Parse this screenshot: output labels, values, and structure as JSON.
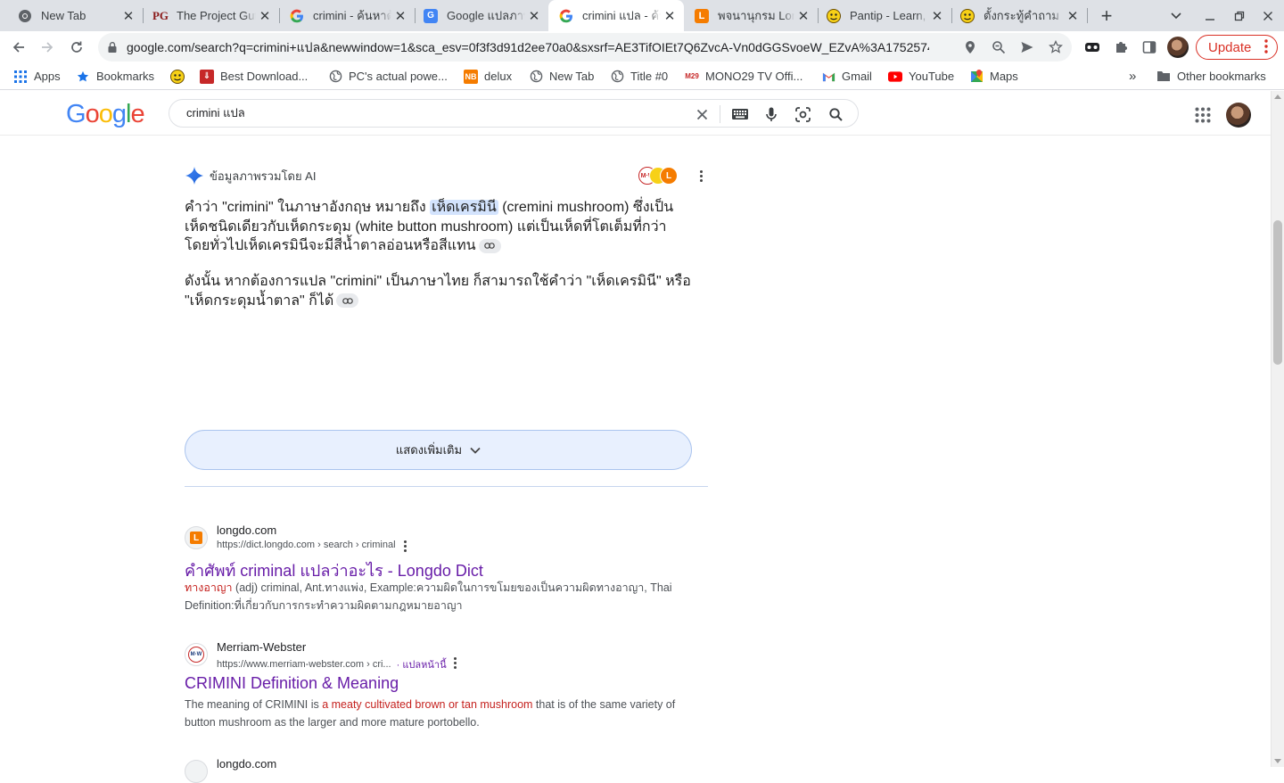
{
  "browser": {
    "tabs": [
      {
        "title": "New Tab",
        "favicon": "chrome-icon",
        "active": false
      },
      {
        "title": "The Project Gutenberg",
        "favicon": "gutenberg-icon",
        "active": false
      },
      {
        "title": "crimini - ค้นหาด้วย Google",
        "favicon": "google-icon",
        "active": false
      },
      {
        "title": "Google แปลภาษา",
        "favicon": "google-translate-icon",
        "active": false
      },
      {
        "title": "crimini แปล - ค้นหาด้วย Google",
        "favicon": "google-icon",
        "active": true
      },
      {
        "title": "พจนานุกรม Longdo",
        "favicon": "longdo-icon",
        "active": false
      },
      {
        "title": "Pantip - Learn, Share",
        "favicon": "pantip-icon",
        "active": false
      },
      {
        "title": "ตั้งกระทู้คำถาม",
        "favicon": "pantip-icon",
        "active": false
      }
    ],
    "address": "google.com/search?q=crimini+แปล&newwindow=1&sca_esv=0f3f3d91d2ee70a0&sxsrf=AE3TifOIEt7Q6ZvcA-Vn0dGGSvoeW_EZvA%3A17525742...",
    "update_label": "Update",
    "bookmarks": [
      {
        "label": "Apps",
        "icon": "apps-grid-icon"
      },
      {
        "label": "Bookmarks",
        "icon": "star-icon"
      },
      {
        "label": "",
        "icon": "pantip-icon"
      },
      {
        "label": "Best Download...",
        "icon": "download-icon"
      },
      {
        "label": "PC's actual powe...",
        "icon": "globe-icon"
      },
      {
        "label": "delux",
        "icon": "nb-icon"
      },
      {
        "label": "New Tab",
        "icon": "globe-icon"
      },
      {
        "label": "Title #0",
        "icon": "globe-icon"
      },
      {
        "label": "MONO29 TV Offi...",
        "icon": "mono29-icon"
      },
      {
        "label": "Gmail",
        "icon": "gmail-icon"
      },
      {
        "label": "YouTube",
        "icon": "youtube-icon"
      },
      {
        "label": "Maps",
        "icon": "maps-icon"
      }
    ],
    "other_bookmarks": "Other bookmarks"
  },
  "search": {
    "query": "crimini แปล"
  },
  "ai_overview": {
    "label": "ข้อมูลภาพรวมโดย AI",
    "para1_before": "คำว่า \"crimini\" ในภาษาอังกฤษ หมายถึง ",
    "para1_highlight": "เห็ดเครมินี",
    "para1_after": " (cremini mushroom) ซึ่งเป็นเห็ดชนิดเดียวกับเห็ดกระดุม (white button mushroom) แต่เป็นเห็ดที่โตเต็มที่กว่า โดยทั่วไปเห็ดเครมินีจะมีสีน้ำตาลอ่อนหรือสีแทน",
    "para2": "ดังนั้น หากต้องการแปล \"crimini\" เป็นภาษาไทย ก็สามารถใช้คำว่า \"เห็ดเครมินี\" หรือ \"เห็ดกระดุมน้ำตาล\" ก็ได้",
    "show_more": "แสดงเพิ่มเติม"
  },
  "results": [
    {
      "site": "longdo.com",
      "url": "https://dict.longdo.com › search › criminal",
      "translate": "",
      "title": "คำศัพท์ criminal แปลว่าอะไร - Longdo Dict",
      "snippet_em": "ทางอาญา",
      "snippet_rest": " (adj) criminal, Ant.ทางแพ่ง, Example:ความผิดในการขโมยของเป็นความผิดทางอาญา, Thai Definition:ที่เกี่ยวกับการกระทำความผิดตามกฎหมายอาญา",
      "favicon": "longdo-icon"
    },
    {
      "site": "Merriam-Webster",
      "url": "https://www.merriam-webster.com › cri...",
      "translate": "· แปลหน้านี้",
      "title": "CRIMINI Definition & Meaning",
      "snippet_pre": "The meaning of CRIMINI is ",
      "snippet_em": "a meaty cultivated brown or tan mushroom",
      "snippet_post": " that is of the same variety of button mushroom as the larger and more mature portobello.",
      "favicon": "merriam-webster-icon"
    },
    {
      "site": "longdo.com",
      "favicon": "longdo-icon"
    }
  ],
  "colors": {
    "link_visited": "#681da8",
    "emphasis_red": "#c5221f",
    "accent_blue": "#1a73e8",
    "update_red": "#d93025"
  }
}
